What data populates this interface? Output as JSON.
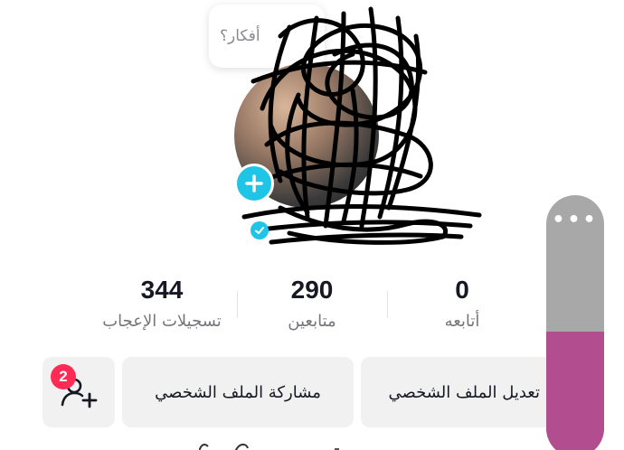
{
  "note": {
    "placeholder": "أفكار؟"
  },
  "stats": [
    {
      "id": "following",
      "value": "0",
      "label": "أتابعه"
    },
    {
      "id": "followers",
      "value": "290",
      "label": "متابعين"
    },
    {
      "id": "likes",
      "value": "344",
      "label": "تسجيلات الإعجاب"
    }
  ],
  "actions": {
    "edit_profile": "تعديل الملف الشخصي",
    "share_profile": "مشاركة الملف الشخصي"
  },
  "friends": {
    "badge_count": "2"
  },
  "scroll_control": {
    "fill_fraction": 0.48
  },
  "colors": {
    "accent_cyan": "#20c4e6",
    "badge_red": "#fe2c55",
    "button_bg": "#f1f1f2",
    "scroll_fill": "#b24d8f"
  },
  "icons": [
    "plus-icon",
    "verified-icon",
    "add-friend-icon",
    "more-dots-icon"
  ]
}
